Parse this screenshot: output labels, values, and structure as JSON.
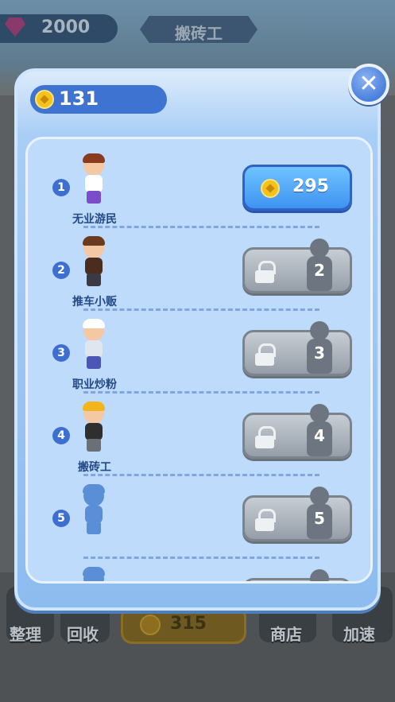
{
  "hud": {
    "gem_count": "2000",
    "title": "搬砖工",
    "bottom": {
      "organize": "整理",
      "recycle": "回收",
      "coins": "315",
      "shop": "商店",
      "speedup": "加速"
    }
  },
  "modal": {
    "coins": "131",
    "close_icon": "close-icon",
    "rows": [
      {
        "num": "1",
        "name": "无业游民",
        "state": "buy",
        "price": "295",
        "colors": {
          "hair": "#8a3b1f",
          "body": "#ffffff",
          "legs": "#7b4dc9"
        }
      },
      {
        "num": "2",
        "name": "推车小贩",
        "state": "locked",
        "lock_num": "2",
        "colors": {
          "hair": "#6b3a1f",
          "body": "#4a2d1e",
          "legs": "#3b3a44"
        }
      },
      {
        "num": "3",
        "name": "职业炒粉",
        "state": "locked",
        "lock_num": "3",
        "colors": {
          "hair": "#ffffff",
          "body": "#dfe6f0",
          "legs": "#4b56b5"
        }
      },
      {
        "num": "4",
        "name": "搬砖工",
        "state": "locked",
        "lock_num": "4",
        "colors": {
          "hair": "#f2b51c",
          "body": "#2f2f2f",
          "legs": "#6b6f78"
        }
      },
      {
        "num": "5",
        "name": "",
        "state": "locked",
        "lock_num": "5",
        "colors": {
          "hair": "#5a8fd8",
          "body": "#5a8fd8",
          "legs": "#5a8fd8"
        }
      }
    ]
  }
}
